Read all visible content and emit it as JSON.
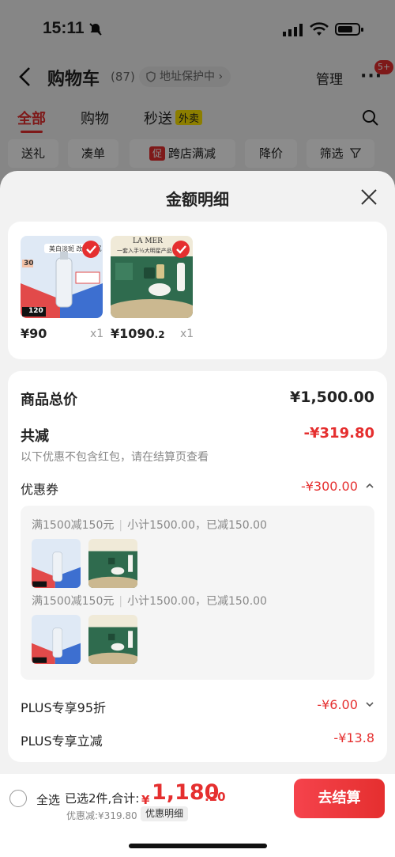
{
  "status_bar": {
    "time": "15:11"
  },
  "nav": {
    "title": "购物车",
    "count": "(87)",
    "protect": "地址保护中",
    "protect_arrow": "›",
    "manage": "管理",
    "more": "···",
    "badge": "5+"
  },
  "tabs": [
    {
      "label": "全部"
    },
    {
      "label": "购物"
    },
    {
      "label": "秒送",
      "tag": "外卖"
    }
  ],
  "chips": [
    {
      "label": "送礼"
    },
    {
      "label": "凑单"
    },
    {
      "label": "跨店满减",
      "tag": "促"
    },
    {
      "label": "降价"
    },
    {
      "label": "筛选"
    }
  ],
  "sheet": {
    "title": "金额明细",
    "products": [
      {
        "price_main": "¥90",
        "price_small": "",
        "qty": "x1",
        "thumb_text": "美白淡斑 改善暗沉",
        "thumb_num": "30",
        "thumb_num2": "120"
      },
      {
        "price_main": "¥1090",
        "price_small": ".2",
        "qty": "x1",
        "thumb_brand": "LA MER",
        "thumb_text": "一套入手½大明星产品"
      }
    ],
    "total_label": "商品总价",
    "total_value": "¥1,500.00",
    "discount_label": "共减",
    "discount_value": "-¥319.80",
    "discount_note": "以下优惠不包含红包，请在结算页查看",
    "coupon_label": "优惠券",
    "coupon_value": "-¥300.00",
    "coupon_lines": [
      {
        "rule": "满1500减150元",
        "detail": "小计1500.00，已减150.00"
      },
      {
        "rule": "满1500减150元",
        "detail": "小计1500.00，已减150.00"
      }
    ],
    "plus95_label": "PLUS专享95折",
    "plus95_value": "-¥6.00",
    "plusoff_label": "PLUS专享立减",
    "plusoff_value": "-¥13.8"
  },
  "bottom": {
    "select_all": "全选",
    "selected": "已选2件,合计:",
    "currency": "¥",
    "sum_int": "1,180",
    "sum_dec": ".20",
    "disc_text": "优惠减:¥319.80",
    "disc_link": "优惠明细",
    "checkout": "去结算"
  },
  "colors": {
    "accent": "#e52f2f",
    "tag_yellow": "#ffe600"
  }
}
